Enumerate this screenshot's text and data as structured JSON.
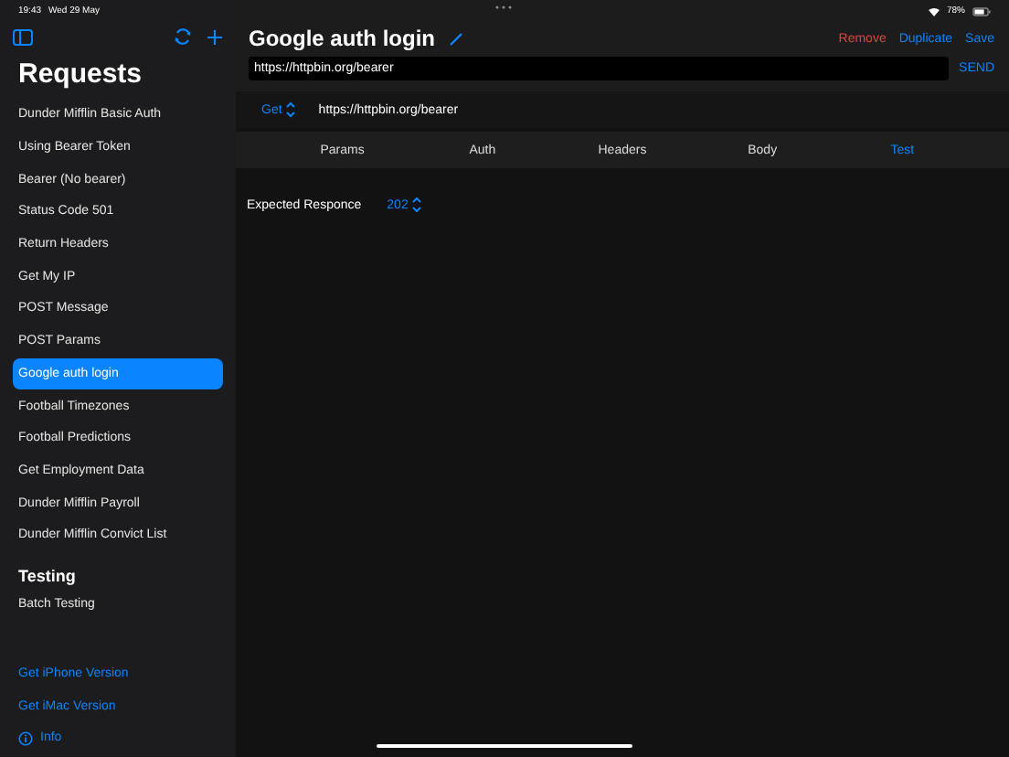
{
  "status_bar": {
    "time": "19:43",
    "date": "Wed 29 May",
    "battery": "78%"
  },
  "sidebar": {
    "title": "Requests",
    "sections": [
      {
        "items": [
          {
            "label": "Dunder Mifflin Basic Auth",
            "selected": false
          },
          {
            "label": "Using Bearer Token",
            "selected": false
          },
          {
            "label": "Bearer (No bearer)",
            "selected": false
          },
          {
            "label": "Status Code 501",
            "selected": false
          },
          {
            "label": "Return Headers",
            "selected": false
          },
          {
            "label": "Get My IP",
            "selected": false
          },
          {
            "label": "POST Message",
            "selected": false
          },
          {
            "label": "POST Params",
            "selected": false
          },
          {
            "label": "Google auth login",
            "selected": true
          },
          {
            "label": "Football Timezones",
            "selected": false
          },
          {
            "label": "Football Predictions",
            "selected": false
          },
          {
            "label": "Get Employment Data",
            "selected": false
          },
          {
            "label": "Dunder Mifflin Payroll",
            "selected": false
          },
          {
            "label": "Dunder Mifflin Convict List",
            "selected": false
          }
        ]
      },
      {
        "heading": "Testing",
        "items": [
          {
            "label": "Batch Testing",
            "selected": false
          }
        ]
      }
    ],
    "links": [
      "Get iPhone Version",
      "Get iMac Version"
    ],
    "info": "Info"
  },
  "request": {
    "title": "Google auth login",
    "actions": [
      {
        "label": "Remove",
        "kind": "danger"
      },
      {
        "label": "Duplicate",
        "kind": "normal"
      },
      {
        "label": "Save",
        "kind": "normal"
      }
    ],
    "url": "https://httpbin.org/bearer",
    "send": "SEND",
    "method": "Get",
    "resolved_url": "https://httpbin.org/bearer",
    "tabs": [
      {
        "label": "Params",
        "selected": false
      },
      {
        "label": "Auth",
        "selected": false
      },
      {
        "label": "Headers",
        "selected": false
      },
      {
        "label": "Body",
        "selected": false
      },
      {
        "label": "Test",
        "selected": true
      }
    ],
    "expected_label": "Expected Responce",
    "expected_value": "202"
  }
}
